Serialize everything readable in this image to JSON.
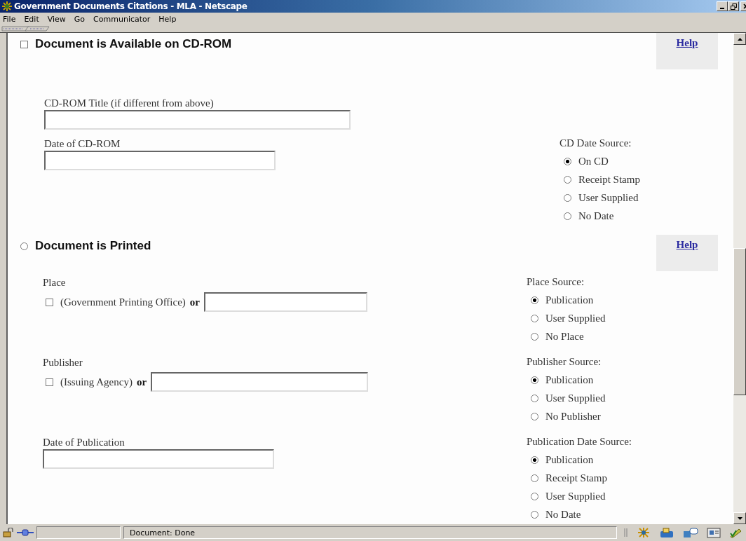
{
  "window": {
    "title": "Government Documents Citations - MLA - Netscape"
  },
  "menu": [
    {
      "label": "File"
    },
    {
      "label": "Edit"
    },
    {
      "label": "View"
    },
    {
      "label": "Go"
    },
    {
      "label": "Communicator"
    },
    {
      "label": "Help"
    }
  ],
  "sections": [
    {
      "kind": "checkbox",
      "title": "Document is Available on CD-ROM",
      "checked": false,
      "help": "Help",
      "rows": [
        {
          "field": {
            "label": "CD-ROM Title (if different from above)",
            "kind": "text"
          }
        },
        {
          "field": {
            "label": "Date of CD-ROM",
            "kind": "text"
          },
          "source": {
            "title": "CD Date Source:",
            "options": [
              {
                "label": "On CD",
                "selected": true
              },
              {
                "label": "Receipt Stamp",
                "selected": false
              },
              {
                "label": "User Supplied",
                "selected": false
              },
              {
                "label": "No Date",
                "selected": false
              }
            ]
          }
        }
      ]
    },
    {
      "kind": "radio",
      "title": "Document is Printed",
      "selected": false,
      "help": "Help",
      "rows": [
        {
          "field": {
            "label": "Place",
            "kind": "choice",
            "option": "(Government Printing Office)",
            "joiner": "or",
            "checked": false
          },
          "source": {
            "title": "Place Source:",
            "options": [
              {
                "label": "Publication",
                "selected": true
              },
              {
                "label": "User Supplied",
                "selected": false
              },
              {
                "label": "No Place",
                "selected": false
              }
            ]
          }
        },
        {
          "field": {
            "label": "Publisher",
            "kind": "choice",
            "option": "(Issuing Agency)",
            "joiner": "or",
            "checked": false
          },
          "source": {
            "title": "Publisher Source:",
            "options": [
              {
                "label": "Publication",
                "selected": true
              },
              {
                "label": "User Supplied",
                "selected": false
              },
              {
                "label": "No Publisher",
                "selected": false
              }
            ]
          }
        },
        {
          "field": {
            "label": "Date of Publication",
            "kind": "text"
          },
          "source": {
            "title": "Publication Date Source:",
            "options": [
              {
                "label": "Publication",
                "selected": true
              },
              {
                "label": "Receipt Stamp",
                "selected": false
              },
              {
                "label": "User Supplied",
                "selected": false
              },
              {
                "label": "No Date",
                "selected": false
              }
            ]
          }
        }
      ]
    }
  ],
  "status_bar": {
    "text": "Document: Done"
  }
}
